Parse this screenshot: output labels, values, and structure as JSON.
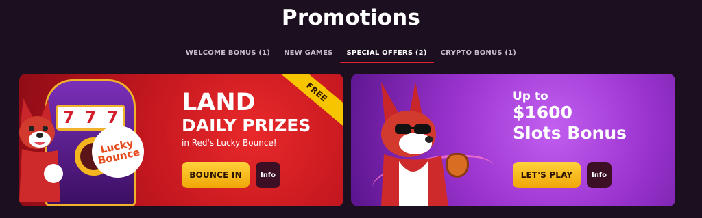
{
  "page": {
    "title": "Promotions"
  },
  "tabs": [
    {
      "label": "WELCOME BONUS (1)",
      "active": false
    },
    {
      "label": "NEW GAMES",
      "active": false
    },
    {
      "label": "SPECIAL OFFERS (2)",
      "active": true
    },
    {
      "label": "CRYPTO BONUS (1)",
      "active": false
    }
  ],
  "cards": [
    {
      "ribbon": "FREE",
      "slot_symbols": [
        "7",
        "7",
        "7"
      ],
      "badge": "Lucky Bounce",
      "headline": "LAND",
      "subheadline": "DAILY PRIZES",
      "caption": "in Red's Lucky Bounce!",
      "cta_label": "BOUNCE IN",
      "info_label": "Info"
    },
    {
      "line1": "Up to",
      "line2": "$1600",
      "line3": "Slots Bonus",
      "cta_label": "LET'S PLAY",
      "info_label": "Info"
    }
  ],
  "colors": {
    "background": "#1c0f1f",
    "tab_active_underline": "#e3223a",
    "button_yellow": "#f7c500",
    "info_button": "#3c0f25"
  },
  "icons": [
    "slot-machine",
    "dog-mascot",
    "sunglasses-dog-mascot",
    "money-bag"
  ]
}
